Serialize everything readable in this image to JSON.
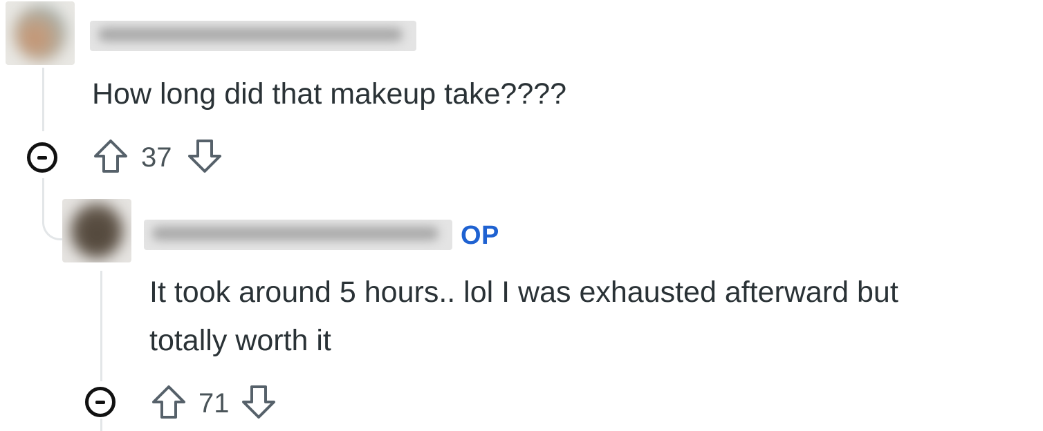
{
  "comments": [
    {
      "text": "How long did that makeup take????",
      "votes": "37",
      "is_op": false
    },
    {
      "op_label": "OP",
      "text_line1": "It took around 5 hours.. lol I was exhausted afterward but",
      "text_line2": "totally worth it",
      "votes": "71",
      "is_op": true
    }
  ],
  "icons": {
    "collapse": "collapse-minus-icon",
    "upvote": "arrow-up-icon",
    "downvote": "arrow-down-icon"
  },
  "colors": {
    "op_badge": "#1f62d1",
    "thread_line": "#e3e6e8",
    "text": "#2a3236"
  }
}
